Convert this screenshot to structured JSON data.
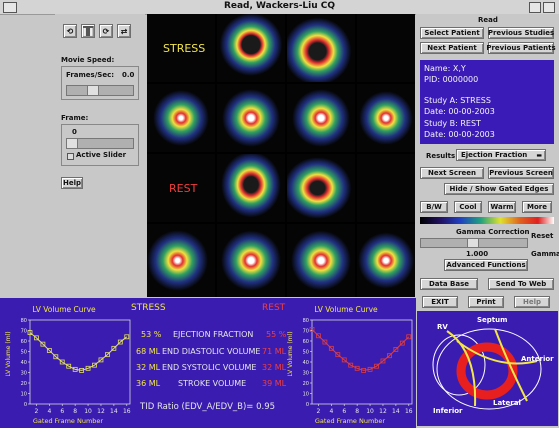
{
  "window": {
    "title": "Read, Wackers-Liu CQ"
  },
  "left_panel": {
    "movie_speed_label": "Movie Speed:",
    "frames_per_sec_label": "Frames/Sec:",
    "frames_per_sec_value": "0.0",
    "frame_label": "Frame:",
    "frame_value": "0",
    "active_slider_label": "Active Slider",
    "help_label": "Help"
  },
  "image_grid": {
    "stress_label": "STRESS",
    "rest_label": "REST"
  },
  "right_panel": {
    "read_label": "Read",
    "select_patient": "Select Patient",
    "previous_studies": "Previous Studies",
    "next_patient": "Next Patient",
    "previous_patients": "Previous Patients",
    "patient_name": "Name: X,Y",
    "patient_pid": "PID: 0000000",
    "study_a": "Study A: STRESS",
    "study_a_date": "Date: 00-00-2003",
    "study_b": "Study B: REST",
    "study_b_date": "Date: 00-00-2003",
    "results_label": "Results:",
    "results_value": "Ejection Fraction",
    "next_screen": "Next Screen",
    "previous_screen": "Previous Screen",
    "hide_show": "Hide / Show Gated Edges",
    "colormaps": [
      "B/W",
      "Cool",
      "Warm",
      "More"
    ],
    "gamma_correction": "Gamma Correction",
    "reset": "Reset",
    "gamma_value": "1.000",
    "gamma_label": "Gamma",
    "advanced": "Advanced Functions",
    "database": "Data Base",
    "send_web": "Send To Web",
    "exit": "EXIT",
    "print": "Print",
    "help": "Help"
  },
  "results": {
    "stress_header": "STRESS",
    "rest_header": "REST",
    "rows": [
      {
        "stress": "53 %",
        "label": "EJECTION FRACTION",
        "rest": "55 %"
      },
      {
        "stress": "68 ML",
        "label": "END DIASTOLIC VOLUME",
        "rest": "71 ML"
      },
      {
        "stress": "32 ML",
        "label": "END SYSTOLIC VOLUME",
        "rest": "32 ML"
      },
      {
        "stress": "36 ML",
        "label": "STROKE VOLUME",
        "rest": "39 ML"
      }
    ],
    "tid": "TID Ratio (EDV_A/EDV_B)= 0.95"
  },
  "diagram": {
    "labels": [
      "RV",
      "Septum",
      "Anterior",
      "Lateral",
      "Inferior"
    ],
    "colors": {
      "ring": "#e81f1f",
      "lines": "#f2e64a",
      "outline": "#ffffff",
      "bg": "#3a1db0"
    }
  },
  "chart_data": [
    {
      "type": "line",
      "title": "LV Volume Curve",
      "xlabel": "Gated Frame Number",
      "ylabel": "LV Volume (ml)",
      "x": [
        1,
        2,
        3,
        4,
        5,
        6,
        7,
        8,
        9,
        10,
        11,
        12,
        13,
        14,
        15,
        16
      ],
      "series": [
        {
          "values": [
            68,
            63,
            57,
            51,
            45,
            40,
            36,
            33,
            32,
            34,
            37,
            42,
            47,
            53,
            59,
            64
          ]
        }
      ],
      "xticks": [
        2,
        4,
        6,
        8,
        10,
        12,
        14,
        16
      ],
      "yticks": [
        0,
        10,
        20,
        30,
        40,
        50,
        60,
        70,
        80
      ],
      "xlim": [
        1,
        16.5
      ],
      "ylim": [
        0,
        80
      ],
      "color": "#e3e35a"
    },
    {
      "type": "line",
      "title": "LV Volume Curve",
      "xlabel": "Gated Frame Number",
      "ylabel": "LV Volume (ml)",
      "x": [
        1,
        2,
        3,
        4,
        5,
        6,
        7,
        8,
        9,
        10,
        11,
        12,
        13,
        14,
        15,
        16
      ],
      "series": [
        {
          "values": [
            71,
            65,
            59,
            53,
            47,
            42,
            37,
            34,
            32,
            33,
            36,
            41,
            46,
            52,
            58,
            64
          ]
        }
      ],
      "xticks": [
        2,
        4,
        6,
        8,
        10,
        12,
        14,
        16
      ],
      "yticks": [
        0,
        10,
        20,
        30,
        40,
        50,
        60,
        70,
        80
      ],
      "xlim": [
        1,
        16.5
      ],
      "ylim": [
        0,
        80
      ],
      "color": "#e23b3b"
    }
  ]
}
